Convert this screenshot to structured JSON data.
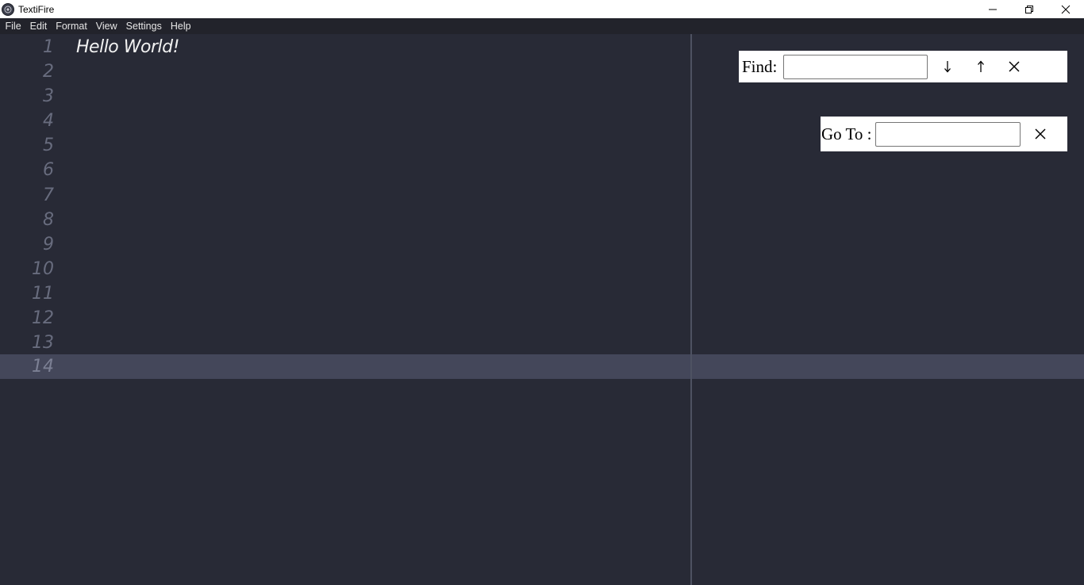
{
  "window": {
    "title": "TextiFire",
    "icons": {
      "app": "app-logo-icon",
      "minimize": "minimize-icon",
      "restore": "restore-icon",
      "close": "close-icon"
    }
  },
  "menu": [
    "File",
    "Edit",
    "Format",
    "View",
    "Settings",
    "Help"
  ],
  "editor": {
    "line_numbers": [
      "1",
      "2",
      "3",
      "4",
      "5",
      "6",
      "7",
      "8",
      "9",
      "10",
      "11",
      "12",
      "13",
      "14"
    ],
    "lines": [
      "Hello World!",
      "",
      "",
      "",
      "",
      "",
      "",
      "",
      "",
      "",
      "",
      "",
      "",
      ""
    ],
    "active_line": 14,
    "colors": {
      "background": "#282a36",
      "active_line": "#44475a",
      "gutter_text": "#686c7e",
      "text": "#f1f1f1"
    }
  },
  "find": {
    "label": "Find:",
    "value": "",
    "icons": {
      "next": "arrow-down-icon",
      "previous": "arrow-up-icon",
      "close": "close-icon"
    }
  },
  "goto": {
    "label": "Go To :",
    "value": "",
    "icons": {
      "close": "close-icon"
    }
  }
}
